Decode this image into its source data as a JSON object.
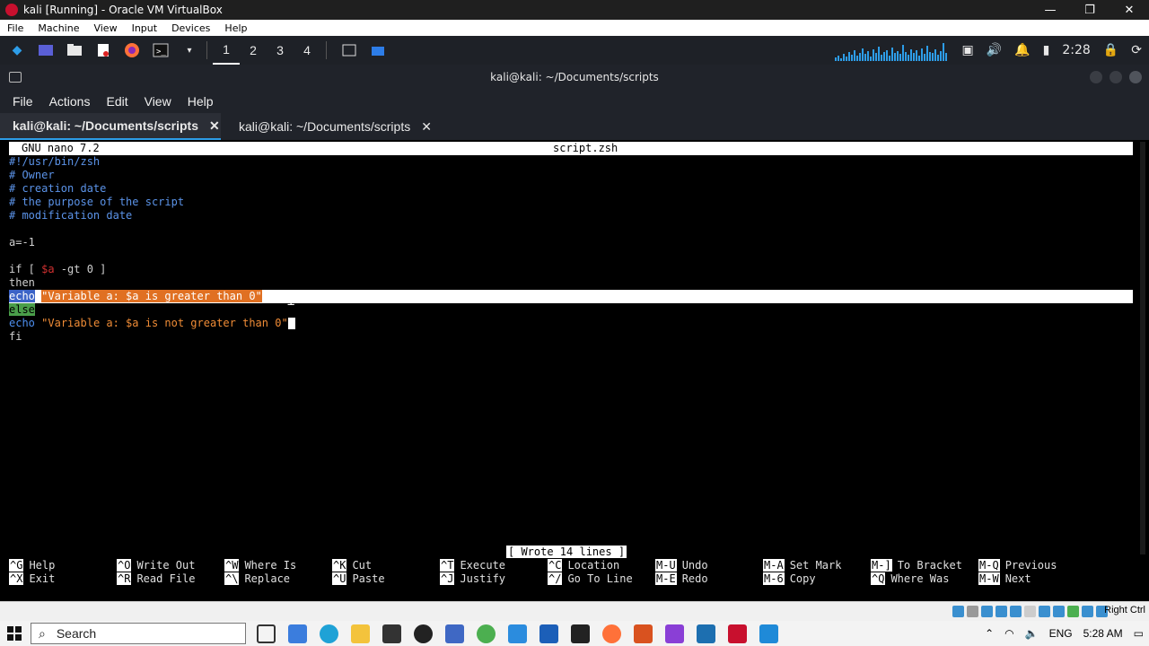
{
  "vbox": {
    "title": "kali [Running] - Oracle VM VirtualBox",
    "menu": [
      "File",
      "Machine",
      "View",
      "Input",
      "Devices",
      "Help"
    ],
    "minimize": "—",
    "restore": "❐",
    "close": "✕"
  },
  "kali_panel": {
    "workspaces": [
      "1",
      "2",
      "3",
      "4"
    ],
    "active_workspace": "1",
    "clock": "2:28"
  },
  "terminal": {
    "window_title": "kali@kali: ~/Documents/scripts",
    "menu": [
      "File",
      "Actions",
      "Edit",
      "View",
      "Help"
    ],
    "tabs": [
      {
        "label": "kali@kali: ~/Documents/scripts",
        "close": "✕"
      },
      {
        "label": "kali@kali: ~/Documents/scripts",
        "close": "✕"
      }
    ]
  },
  "nano": {
    "version": "GNU nano 7.2",
    "filename": "script.zsh",
    "lines": {
      "l1": "#!/usr/bin/zsh",
      "l2": "# Owner",
      "l3": "# creation date",
      "l4": "# the purpose of the script",
      "l5": "# modification date",
      "l7": "a=-1",
      "l9_a": "if [ ",
      "l9_b": "$a",
      "l9_c": " -gt 0 ]",
      "l10": "then",
      "l11_a": "echo",
      "l11_b": "\"Variable a: $a is greater than 0\"",
      "l12": "else",
      "l13_a": "echo",
      "l13_b": "\"Variable a: $a is not greater than 0\"",
      "l14": "fi"
    },
    "status_message": "[ Wrote 14 lines ]",
    "shortcuts": [
      {
        "key": "^G",
        "label": "Help"
      },
      {
        "key": "^X",
        "label": "Exit"
      },
      {
        "key": "^O",
        "label": "Write Out"
      },
      {
        "key": "^R",
        "label": "Read File"
      },
      {
        "key": "^W",
        "label": "Where Is"
      },
      {
        "key": "^\\",
        "label": "Replace"
      },
      {
        "key": "^K",
        "label": "Cut"
      },
      {
        "key": "^U",
        "label": "Paste"
      },
      {
        "key": "^T",
        "label": "Execute"
      },
      {
        "key": "^J",
        "label": "Justify"
      },
      {
        "key": "^C",
        "label": "Location"
      },
      {
        "key": "^/",
        "label": "Go To Line"
      },
      {
        "key": "M-U",
        "label": "Undo"
      },
      {
        "key": "M-E",
        "label": "Redo"
      },
      {
        "key": "M-A",
        "label": "Set Mark"
      },
      {
        "key": "M-6",
        "label": "Copy"
      },
      {
        "key": "M-]",
        "label": "To Bracket"
      },
      {
        "key": "^Q",
        "label": "Where Was"
      },
      {
        "key": "M-Q",
        "label": "Previous"
      },
      {
        "key": "M-W",
        "label": "Next"
      }
    ]
  },
  "windows": {
    "search_placeholder": "Search",
    "right_ctrl": "Right Ctrl",
    "time": "5:28 AM",
    "lang": "ENG"
  },
  "colors": {
    "kali_panel": "#1e2127",
    "accent": "#2d9de8",
    "echo_highlight": "#3b63c7",
    "string_highlight": "#e07022",
    "else_highlight": "#4a9e4a"
  }
}
